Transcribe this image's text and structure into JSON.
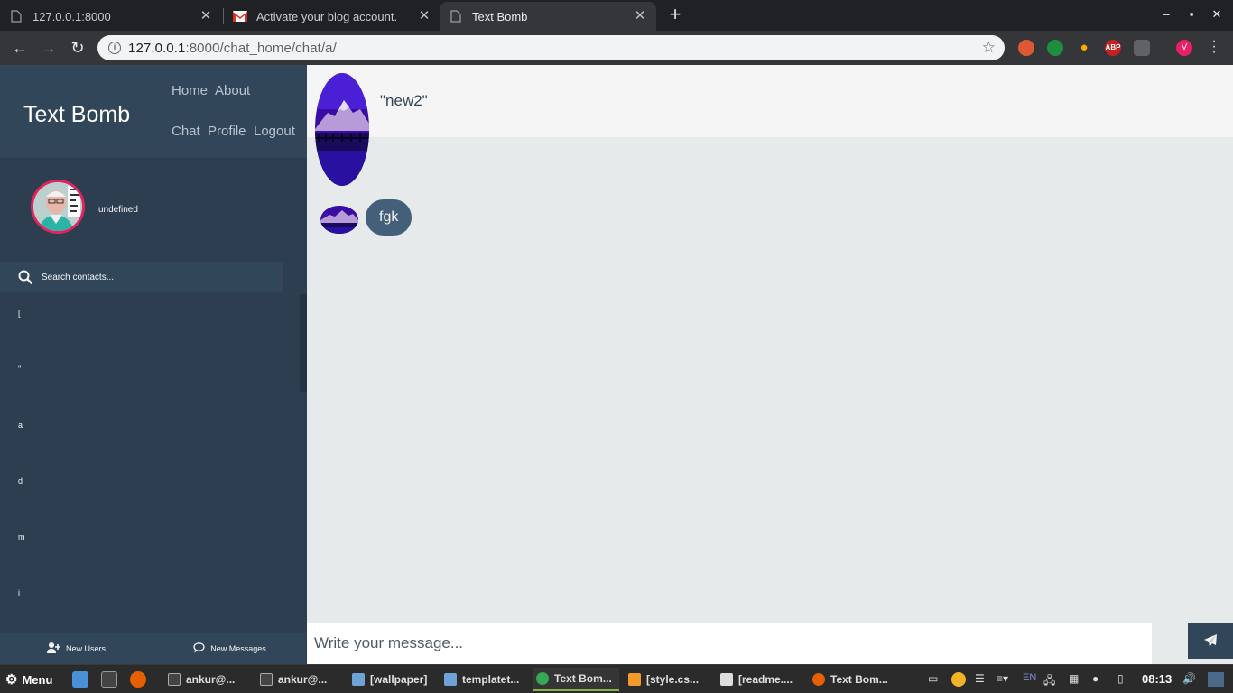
{
  "browser": {
    "tabs": [
      {
        "title": "127.0.0.1:8000",
        "icon": "page-icon"
      },
      {
        "title": "Activate your blog account.",
        "icon": "gmail-icon"
      },
      {
        "title": "Text Bomb",
        "icon": "page-icon",
        "active": true
      }
    ],
    "url_host": "127.0.0.1",
    "url_rest": ":8000/chat_home/chat/a/",
    "profile_initial": "V",
    "abp_label": "ABP"
  },
  "sidebar": {
    "brand": "Text Bomb",
    "nav": [
      "Home",
      "About",
      "Chat",
      "Profile",
      "Logout"
    ],
    "profile_name": "undefined",
    "search_placeholder": "Search contacts...",
    "contacts": [
      "[",
      "\"",
      "a",
      "d",
      "m",
      "i"
    ],
    "bottom": {
      "new_users": "New Users",
      "new_messages": "New Messages"
    }
  },
  "chat": {
    "contact_name": "\"new2\"",
    "messages": [
      {
        "text": "fgk",
        "direction": "received"
      }
    ],
    "input_placeholder": "Write your message..."
  },
  "taskbar": {
    "menu_label": "Menu",
    "windows": [
      "ankur@...",
      "ankur@...",
      "[wallpaper]",
      "templatet...",
      "Text Bom...",
      "[style.cs...",
      "[readme....",
      "Text Bom..."
    ],
    "keyboard_layout": "EN",
    "clock": "08:13"
  },
  "colors": {
    "sidebar_bg": "#2c3e50",
    "sidebar_panel": "#32465a",
    "bubble": "#435f7a",
    "avatar_ring": "#e0245e",
    "chat_bg": "#e6eaea"
  }
}
